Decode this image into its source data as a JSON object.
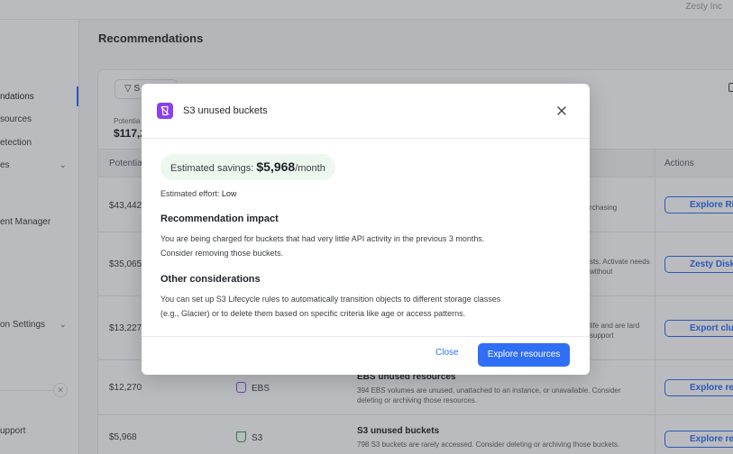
{
  "topbar": {
    "user": "Zesty Inc"
  },
  "sidebar": {
    "items": [
      {
        "label": "ndations"
      },
      {
        "label": "sources"
      },
      {
        "label": "etection"
      },
      {
        "label": "es"
      },
      {
        "label": "ent Manager"
      },
      {
        "label": "on Settings"
      },
      {
        "label": "upport"
      }
    ]
  },
  "page": {
    "title": "Recommendations"
  },
  "panel": {
    "filter_label": "S",
    "potential_label": "Potentia",
    "potential_value": "$117,2",
    "columns": {
      "potential": "Potentia",
      "actions": "Actions"
    }
  },
  "rows": [
    {
      "value": "$43,442",
      "desc_right": "rchasing",
      "action": "Explore RD"
    },
    {
      "value": "$35,065",
      "desc_right": "sts. Activate needs without",
      "action": "Zesty Disk pa"
    },
    {
      "value": "$13,227",
      "desc_right": "life and are lard support",
      "action": "Export clust"
    },
    {
      "value": "$12,270",
      "service": "EBS",
      "title": "EBS unused resources",
      "desc": "394 EBS volumes are unused, unattached to an instance, or unavailable. Consider deleting or archiving those resources.",
      "action": "Explore resou"
    },
    {
      "value": "$5,968",
      "service": "S3",
      "title": "S3 unused buckets",
      "desc": "798 S3 buckets are rarely accessed. Consider deleting or archiving those buckets.",
      "action": "Explore resou"
    }
  ],
  "modal": {
    "title": "S3 unused buckets",
    "savings_label": "Estimated savings: ",
    "savings_value": "$5,968",
    "savings_unit": "/month",
    "effort_label": "Estimated effort:",
    "effort_value": "Low",
    "impact_title": "Recommendation impact",
    "impact_line1": "You are being charged for buckets that had very little API activity in the previous 3 months.",
    "impact_line2": "Consider removing those buckets.",
    "other_title": "Other considerations",
    "other_line1": "You can set up S3 Lifecycle rules to automatically transition objects to different storage classes",
    "other_line2": "(e.g., Glacier) or to delete them based on specific criteria like age or access patterns.",
    "close_label": "Close",
    "explore_label": "Explore resources"
  },
  "colors": {
    "accent": "#2f6ff5",
    "modal_icon": "#8a3ff0",
    "savings_bg": "#ecf7ee"
  }
}
